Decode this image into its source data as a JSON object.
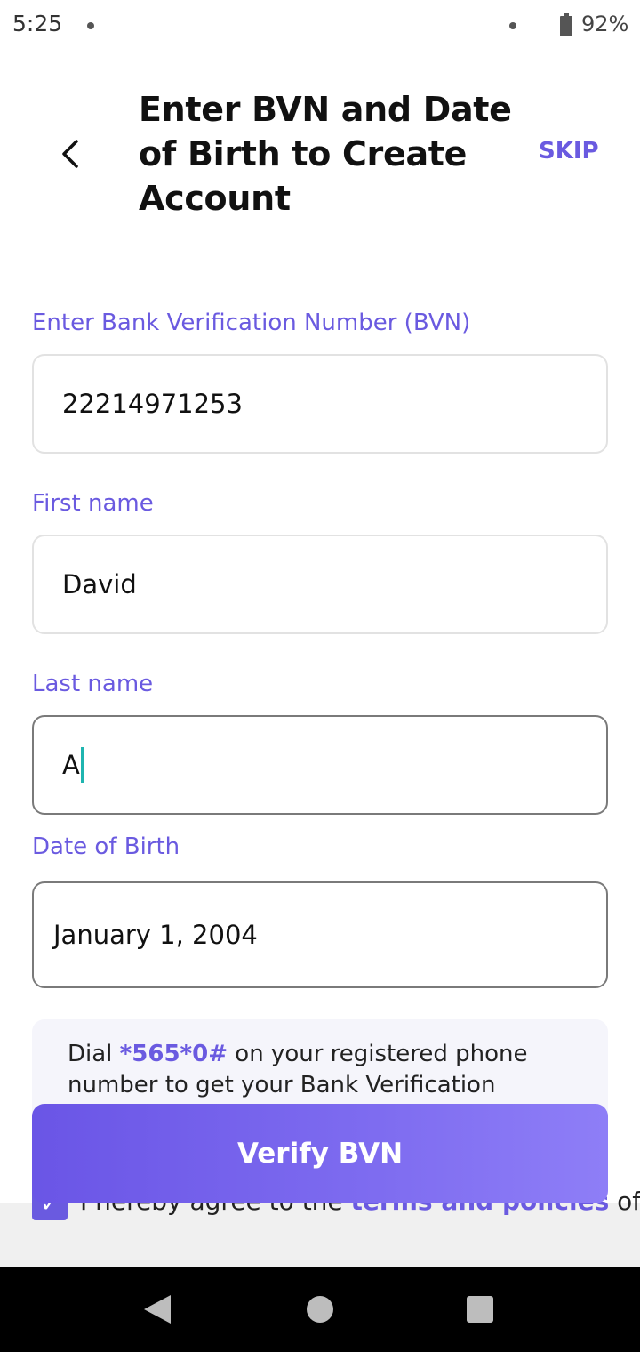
{
  "status_bar": {
    "time": "5:25",
    "battery": "92%"
  },
  "header": {
    "title": "Enter BVN and Date of Birth to Create Account",
    "skip_label": "SKIP"
  },
  "form": {
    "bvn": {
      "label": "Enter Bank Verification Number (BVN)",
      "value": "22214971253"
    },
    "first_name": {
      "label": "First name",
      "value": "David"
    },
    "last_name": {
      "label": "Last name",
      "value": "A"
    },
    "dob": {
      "label": "Date of Birth",
      "value": "January 1, 2004"
    }
  },
  "info": {
    "prefix": "Dial ",
    "code": "*565*0#",
    "suffix": " on your registered phone number to get your Bank Verification Number"
  },
  "agreement": {
    "prefix": "I hereby agree to the ",
    "link": "terms and policies",
    "suffix": " of Stash"
  },
  "verify_label": "Verify BVN",
  "colors": {
    "accent": "#6A5AE0",
    "caret": "#1FB5B0"
  }
}
